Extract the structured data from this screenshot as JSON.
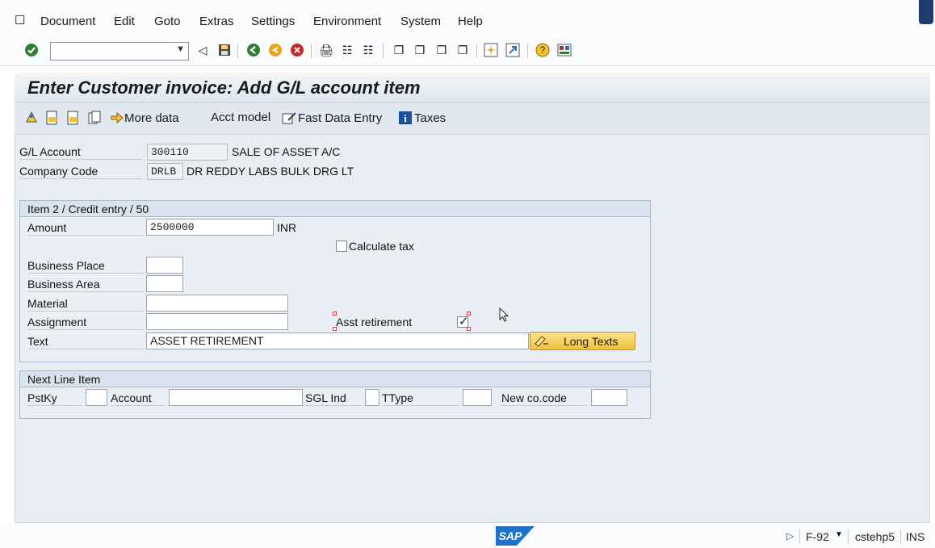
{
  "menu": {
    "items": [
      {
        "label": "Document"
      },
      {
        "label": "Edit"
      },
      {
        "label": "Goto"
      },
      {
        "label": "Extras"
      },
      {
        "label": "Settings"
      },
      {
        "label": "Environment"
      },
      {
        "label": "System"
      },
      {
        "label": "Help"
      }
    ]
  },
  "toolbar": {
    "command_field_value": ""
  },
  "page": {
    "title": "Enter Customer invoice: Add G/L account item"
  },
  "app_toolbar": {
    "more_data": "More data",
    "acct_model": "Acct model",
    "fast_data_entry": "Fast Data Entry",
    "taxes": "Taxes"
  },
  "header": {
    "gl_account_label": "G/L Account",
    "gl_account_value": "300110",
    "gl_account_desc": "SALE OF ASSET A/C",
    "company_code_label": "Company Code",
    "company_code_value": "DRLB",
    "company_code_desc": "DR REDDY LABS BULK DRG LT"
  },
  "item": {
    "group_title": "Item 2 / Credit entry / 50",
    "amount_label": "Amount",
    "amount_value": "2500000",
    "currency": "INR",
    "calculate_tax_label": "Calculate tax",
    "calculate_tax_checked": false,
    "business_place_label": "Business Place",
    "business_place_value": "",
    "business_area_label": "Business Area",
    "business_area_value": "",
    "material_label": "Material",
    "material_value": "",
    "assignment_label": "Assignment",
    "assignment_value": "",
    "asst_retirement_label": "Asst retirement",
    "asst_retirement_checked": true,
    "text_label": "Text",
    "text_value": "ASSET RETIREMENT",
    "long_texts_button": "Long Texts"
  },
  "next_line": {
    "group_title": "Next Line Item",
    "pstky_label": "PstKy",
    "pstky_value": "",
    "account_label": "Account",
    "account_value": "",
    "sgl_ind_label": "SGL Ind",
    "sgl_ind_value": "",
    "ttype_label": "TType",
    "ttype_value": "",
    "new_co_code_label": "New co.code",
    "new_co_code_value": ""
  },
  "status": {
    "brand": "SAP",
    "transaction": "F-92",
    "server": "cstehp5",
    "mode": "INS"
  },
  "colors": {
    "title_bg": "#e3eaf1",
    "workarea_bg": "#e7edf3",
    "group_bg": "#e9eff5",
    "button_yellow": "#f0c33f",
    "sap_blue": "#1d73c9"
  }
}
